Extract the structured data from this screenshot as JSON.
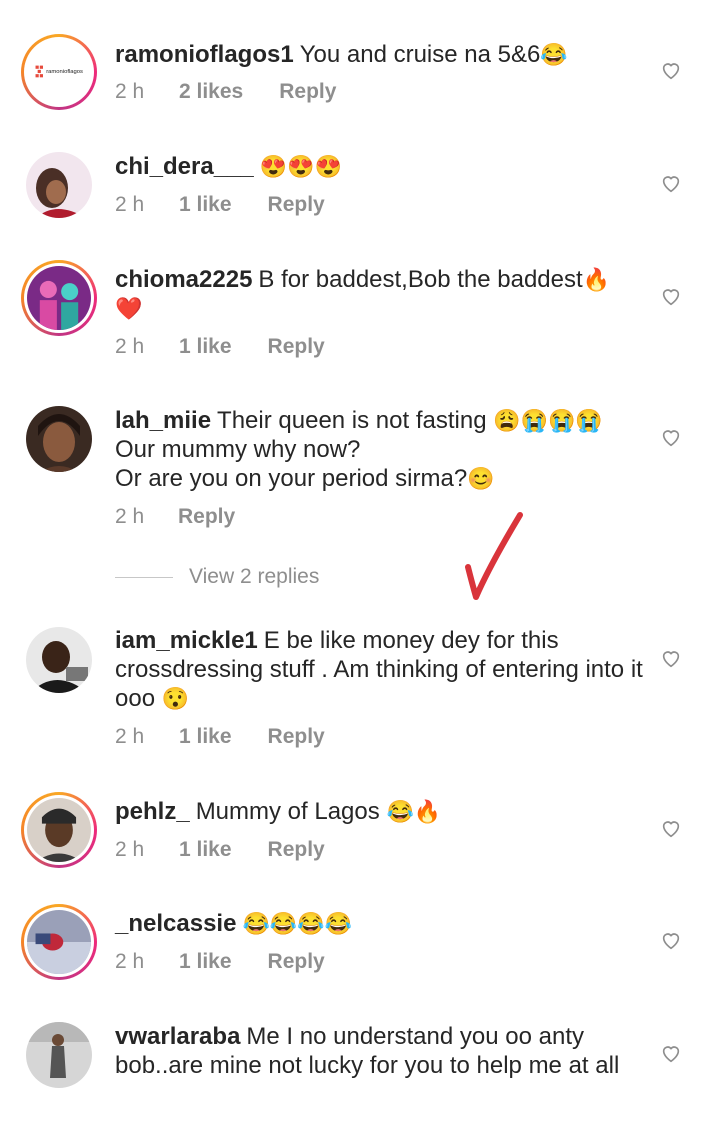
{
  "comments": [
    {
      "username": "ramonioflagos1",
      "text": "You and cruise na 5&6",
      "emoji": "😂",
      "time": "2 h",
      "likes": "2 likes",
      "reply": "Reply",
      "avatar_text": "ramonioflagos"
    },
    {
      "username": "chi_dera___",
      "text": "",
      "emoji": "😍😍😍",
      "time": "2 h",
      "likes": "1 like",
      "reply": "Reply"
    },
    {
      "username": "chioma2225",
      "text": "B for baddest,Bob the baddest",
      "emoji": "🔥",
      "emoji2": "❤️",
      "time": "2 h",
      "likes": "1 like",
      "reply": "Reply"
    },
    {
      "username": "lah_miie",
      "text": "Their queen is not fasting",
      "emoji": "😩😭😭😭",
      "line2": "Our mummy why now?",
      "line3": "Or are you on your period sirma?",
      "emoji3": "😊",
      "time": "2 h",
      "likes": "",
      "reply": "Reply"
    },
    {
      "username": "iam_mickle1",
      "text": "E be like money dey for this crossdressing stuff . Am thinking of entering into it ooo",
      "emoji": "😯",
      "time": "2 h",
      "likes": "1 like",
      "reply": "Reply"
    },
    {
      "username": "pehlz_",
      "text": "Mummy of Lagos",
      "emoji": "😂🔥",
      "time": "2 h",
      "likes": "1 like",
      "reply": "Reply"
    },
    {
      "username": "_nelcassie",
      "text": "",
      "emoji": "😂😂😂😂",
      "time": "2 h",
      "likes": "1 like",
      "reply": "Reply"
    },
    {
      "username": "vwarlaraba",
      "text": "Me I no understand you oo anty bob..are mine not lucky for you to help me at all",
      "emoji": ""
    }
  ],
  "view_replies": "View 2 replies",
  "colors": {
    "text": "#262626",
    "muted": "#8e8e8e",
    "mark": "#d9343b"
  },
  "icons": {
    "like": "heart-outline-icon"
  }
}
